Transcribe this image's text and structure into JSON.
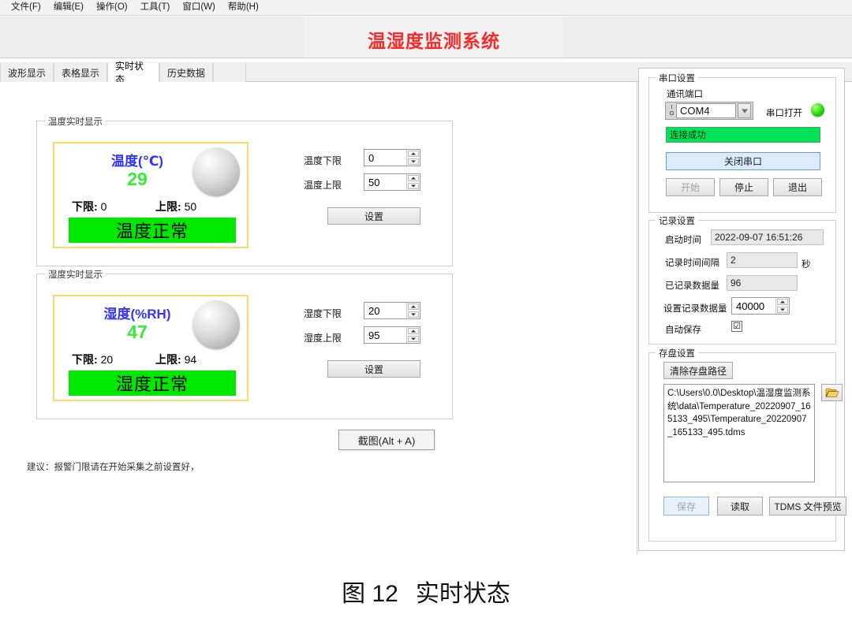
{
  "menubar": {
    "items": [
      {
        "label": "文件(F)"
      },
      {
        "label": "编辑(E)"
      },
      {
        "label": "操作(O)"
      },
      {
        "label": "工具(T)"
      },
      {
        "label": "窗口(W)"
      },
      {
        "label": "帮助(H)"
      }
    ]
  },
  "header": {
    "title": "温湿度监测系统",
    "title_color": "#f82a2a"
  },
  "tabs": [
    {
      "label": "波形显示",
      "selected": false
    },
    {
      "label": "表格显示",
      "selected": false
    },
    {
      "label": "实时状态",
      "selected": true
    },
    {
      "label": "历史数据",
      "selected": false
    }
  ],
  "temperature": {
    "group_title": "温度实时显示",
    "readout_label": "温度(℃)",
    "value": "29",
    "lower_caption": "下限:",
    "lower_value": "0",
    "upper_caption": "上限:",
    "upper_value": "50",
    "status": "温度正常",
    "status_color": "#00e800",
    "value_color": "#33ee33",
    "label_color": "#3333ff",
    "lower_limit_label": "温度下限",
    "lower_limit_input": "0",
    "upper_limit_label": "温度上限",
    "upper_limit_input": "50",
    "set_button": "设置"
  },
  "humidity": {
    "group_title": "湿度实时显示",
    "readout_label": "湿度(%RH)",
    "value": "47",
    "lower_caption": "下限:",
    "lower_value": "20",
    "upper_caption": "上限:",
    "upper_value": "94",
    "status": "湿度正常",
    "status_color": "#00e800",
    "lower_limit_label": "湿度下限",
    "lower_limit_input": "20",
    "upper_limit_label": "湿度上限",
    "upper_limit_input": "95",
    "set_button": "设置"
  },
  "snapshot_button": "截图(Alt + A)",
  "hint": "建议：报警门限请在开始采集之前设置好，",
  "serial": {
    "group_title": "串口设置",
    "port_label": "通讯端口",
    "port_value": "COM4",
    "open_label": "串口打开",
    "led_color": "#19cf10",
    "status_text": "连接成功",
    "status_bg": "#00e359",
    "close_button": "关闭串口",
    "start_button": "开始",
    "stop_button": "停止",
    "exit_button": "退出"
  },
  "record": {
    "group_title": "记录设置",
    "start_time_label": "启动时间",
    "start_time_value": "2022-09-07 16:51:26",
    "interval_label": "记录时间间隔",
    "interval_value": "2",
    "interval_unit": "秒",
    "recorded_label": "已记录数据量",
    "recorded_value": "96",
    "set_count_label": "设置记录数据量",
    "set_count_value": "40000",
    "autosave_label": "自动保存",
    "autosave_checked": "☑"
  },
  "storage": {
    "group_title": "存盘设置",
    "clear_button": "清除存盘路径",
    "path": "C:\\Users\\0.0\\Desktop\\温湿度监测系统\\data\\Temperature_20220907_165133_495\\Temperature_20220907_165133_495.tdms",
    "folder_icon": "open-folder-icon",
    "save_button": "保存",
    "read_button": "读取",
    "preview_button": "TDMS 文件预览"
  },
  "figure_caption": {
    "number": "图 12",
    "text": "实时状态"
  }
}
